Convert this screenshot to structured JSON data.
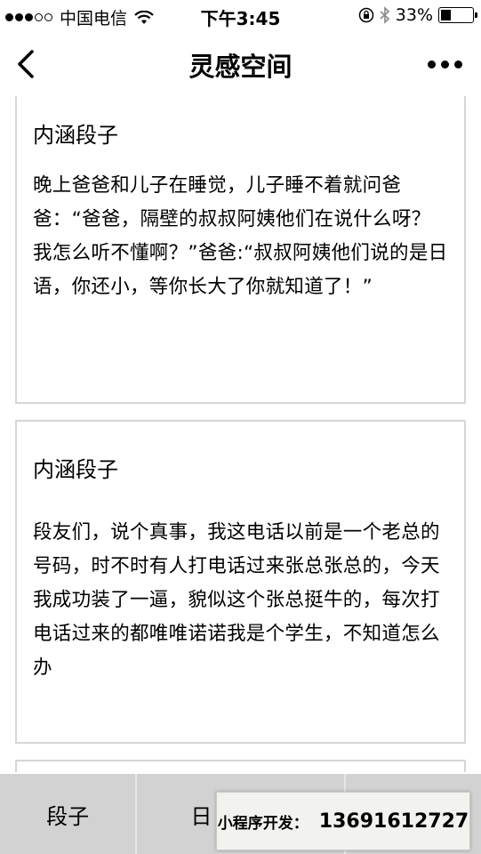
{
  "status_bar": {
    "carrier": "中国电信",
    "time": "下午3:45",
    "battery": "33%",
    "battery_level": 0.33
  },
  "nav": {
    "title": "灵感空间"
  },
  "posts": [
    {
      "title": "内涵段子",
      "body": "晚上爸爸和儿子在睡觉，儿子睡不着就问爸爸：“爸爸，隔壁的叔叔阿姨他们在说什么呀？我怎么听不懂啊？”爸爸:“叔叔阿姨他们说的是日语，你还小，等你长大了你就知道了！”"
    },
    {
      "title": "内涵段子",
      "body": "段友们，说个真事，我这电话以前是一个老总的号码，时不时有人打电话过来张总张总的，今天我成功装了一逼，貌似这个张总挺牛的，每次打电话过来的都唯唯诺诺我是个学生，不知道怎么办"
    }
  ],
  "tabs": [
    {
      "label": "段子"
    },
    {
      "label": "日"
    },
    {
      "label": ""
    }
  ],
  "dev_banner": {
    "label": "小程序开发：",
    "phone": "13691612727"
  }
}
